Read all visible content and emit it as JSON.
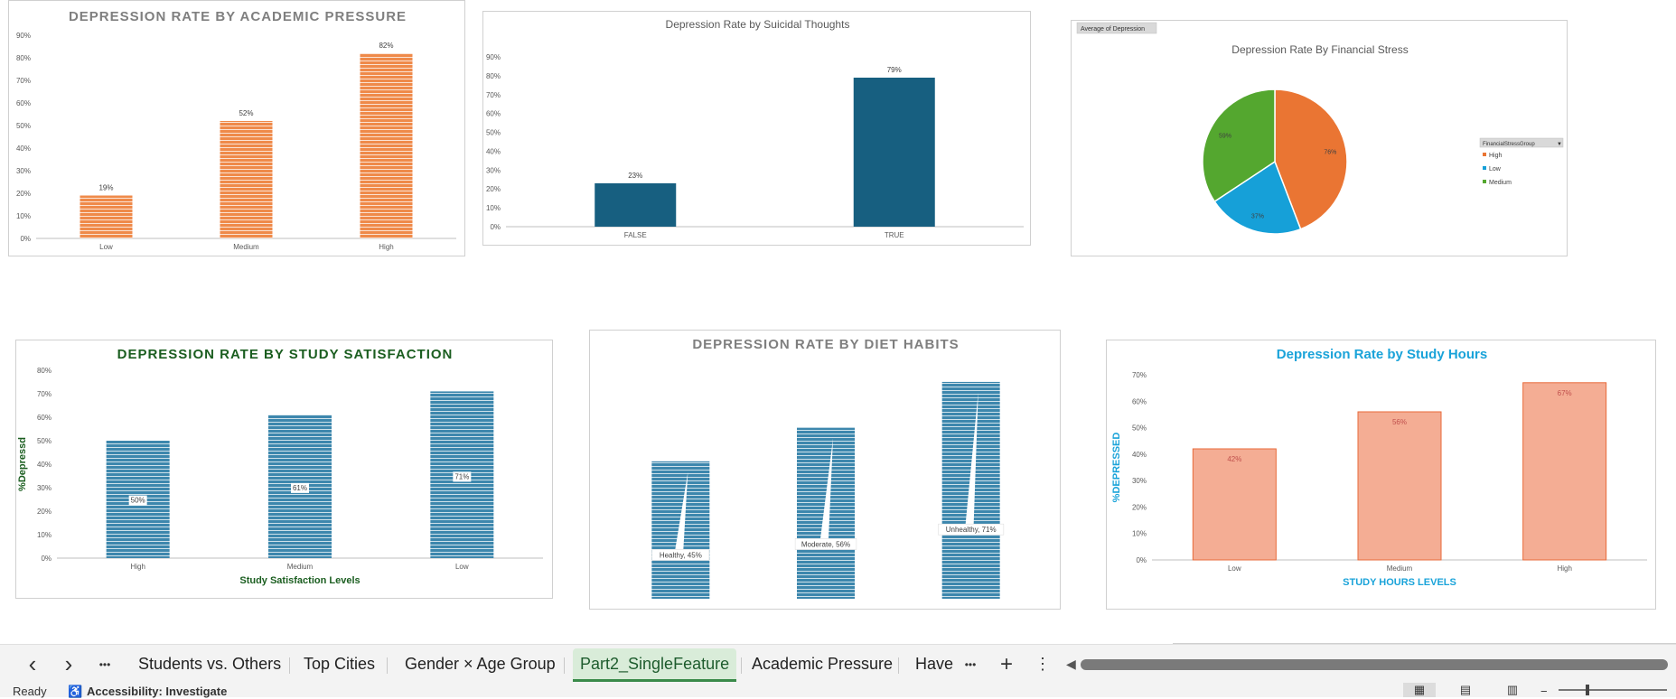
{
  "charts": [
    {
      "id": "c1",
      "title": "DEPRESSION RATE BY ACADEMIC PRESSURE",
      "categories": [
        "Low",
        "Medium",
        "High"
      ],
      "values": [
        19,
        52,
        82
      ],
      "labels": [
        "19%",
        "52%",
        "82%"
      ],
      "yticks": [
        "0%",
        "10%",
        "20%",
        "30%",
        "40%",
        "50%",
        "60%",
        "70%",
        "80%",
        "90%"
      ],
      "color": "#ef8a4a"
    },
    {
      "id": "c2",
      "title": "Depression Rate by Suicidal Thoughts",
      "categories": [
        "FALSE",
        "TRUE"
      ],
      "values": [
        23,
        79
      ],
      "labels": [
        "23%",
        "79%"
      ],
      "yticks": [
        "0%",
        "10%",
        "20%",
        "30%",
        "40%",
        "50%",
        "60%",
        "70%",
        "80%",
        "90%"
      ],
      "color": "#175f80"
    },
    {
      "id": "c4",
      "title": "DEPRESSION RATE BY STUDY SATISFACTION",
      "categories": [
        "High",
        "Medium",
        "Low"
      ],
      "values": [
        50,
        61,
        71
      ],
      "labels": [
        "50%",
        "61%",
        "71%"
      ],
      "yticks": [
        "0%",
        "10%",
        "20%",
        "30%",
        "40%",
        "50%",
        "60%",
        "70%",
        "80%"
      ],
      "ylabel": "%Depressd",
      "xlabel": "Study Satisfaction Levels",
      "color": "#3d87ad"
    },
    {
      "id": "c5",
      "title": "DEPRESSION RATE BY DIET HABITS",
      "categories": [
        "Healthy",
        "Moderate",
        "Unhealthy"
      ],
      "values": [
        45,
        56,
        71
      ],
      "labels": [
        "Healthy, 45%",
        "Moderate, 56%",
        "Unhealthy, 71%"
      ],
      "color": "#3d87ad"
    },
    {
      "id": "c6",
      "title": "Depression Rate by Study Hours",
      "categories": [
        "Low",
        "Medium",
        "High"
      ],
      "values": [
        42,
        56,
        67
      ],
      "labels": [
        "42%",
        "56%",
        "67%"
      ],
      "yticks": [
        "0%",
        "10%",
        "20%",
        "30%",
        "40%",
        "50%",
        "60%",
        "70%"
      ],
      "ylabel": "%DEPRESSED",
      "xlabel": "STUDY HOURS LEVELS",
      "color": "#f4ad94"
    }
  ],
  "pie": {
    "title": "Depression Rate By Financial Stress",
    "field_button": "Average of Depression",
    "legend_field": "FinancialStressGroup",
    "slices": [
      {
        "name": "High",
        "value": 76,
        "label": "76%",
        "color": "#ea7533"
      },
      {
        "name": "Low",
        "value": 37,
        "label": "37%",
        "color": "#16a0d8"
      },
      {
        "name": "Medium",
        "value": 59,
        "label": "59%",
        "color": "#54a72f"
      }
    ]
  },
  "tabs": {
    "items": [
      "Students vs. Others",
      "Top Cities",
      "Gender × Age Group",
      "Part2_SingleFeature",
      "Academic Pressure",
      "Have"
    ],
    "active": "Part2_SingleFeature",
    "prev_icon": "‹",
    "next_icon": "›",
    "more_icon": "•••",
    "add_icon": "+",
    "menu_icon": "⋮"
  },
  "status": {
    "ready": "Ready",
    "accessibility": "Accessibility: Investigate"
  }
}
